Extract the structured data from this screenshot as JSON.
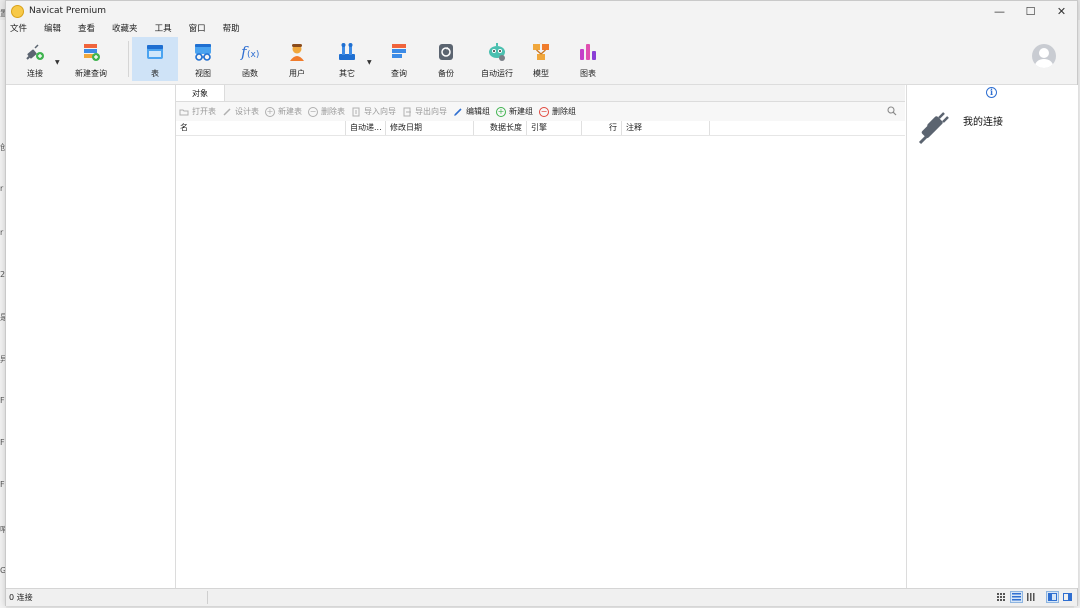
{
  "window": {
    "title": "Navicat Premium"
  },
  "window_controls": {
    "minimize": "—",
    "maximize": "☐",
    "close": "✕"
  },
  "menu": [
    "文件",
    "编辑",
    "查看",
    "收藏夹",
    "工具",
    "窗口",
    "帮助"
  ],
  "toolbar": {
    "connect": "连接",
    "new_query": "新建查询",
    "table": "表",
    "view": "视图",
    "function": "函数",
    "user": "用户",
    "other": "其它",
    "query": "查询",
    "backup": "备份",
    "automation": "自动运行",
    "model": "模型",
    "chart": "图表"
  },
  "tabs": [
    "对象"
  ],
  "object_toolbar": {
    "open_table": "打开表",
    "design_table": "设计表",
    "new_table": "新建表",
    "delete_table": "删除表",
    "import_wizard": "导入向导",
    "export_wizard": "导出向导",
    "edit_group": "编辑组",
    "new_group": "新建组",
    "delete_group": "删除组"
  },
  "grid_columns": [
    "名",
    "自动递...",
    "修改日期",
    "数据长度",
    "引擎",
    "行",
    "注释"
  ],
  "info_panel": {
    "title": "我的连接"
  },
  "status": {
    "connections": "0 连接"
  },
  "background_glyphs": [
    "置",
    "创",
    "r",
    "r",
    "2(",
    "是",
    "异",
    "F",
    "F",
    "F",
    "哺",
    "Gi"
  ],
  "colors": {
    "active_tab_bg": "#cfe3f7",
    "accent": "#2f6fd1"
  }
}
